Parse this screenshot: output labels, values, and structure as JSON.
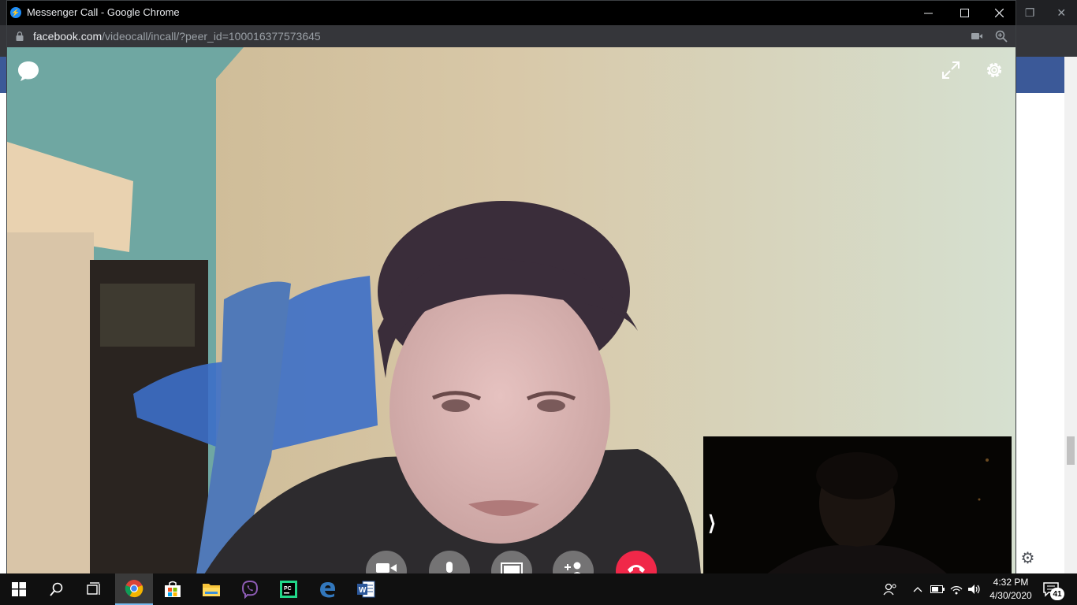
{
  "popup": {
    "window_title": "Messenger Call - Google Chrome",
    "url_host": "facebook.com",
    "url_path": "/videocall/incall/?peer_id=100016377573645"
  },
  "call_controls": [
    "camera",
    "microphone",
    "screen-share",
    "add-person",
    "end-call"
  ],
  "colors": {
    "end_call": "#f02849",
    "facebook_blue": "#3b5998",
    "messenger_blue": "#1d8cf8"
  },
  "taskbar": {
    "apps": [
      "start",
      "search",
      "task-view",
      "chrome",
      "microsoft-store",
      "file-explorer",
      "viber",
      "pycharm",
      "edge",
      "word"
    ],
    "time": "4:32 PM",
    "date": "4/30/2020",
    "notification_count": "41"
  }
}
